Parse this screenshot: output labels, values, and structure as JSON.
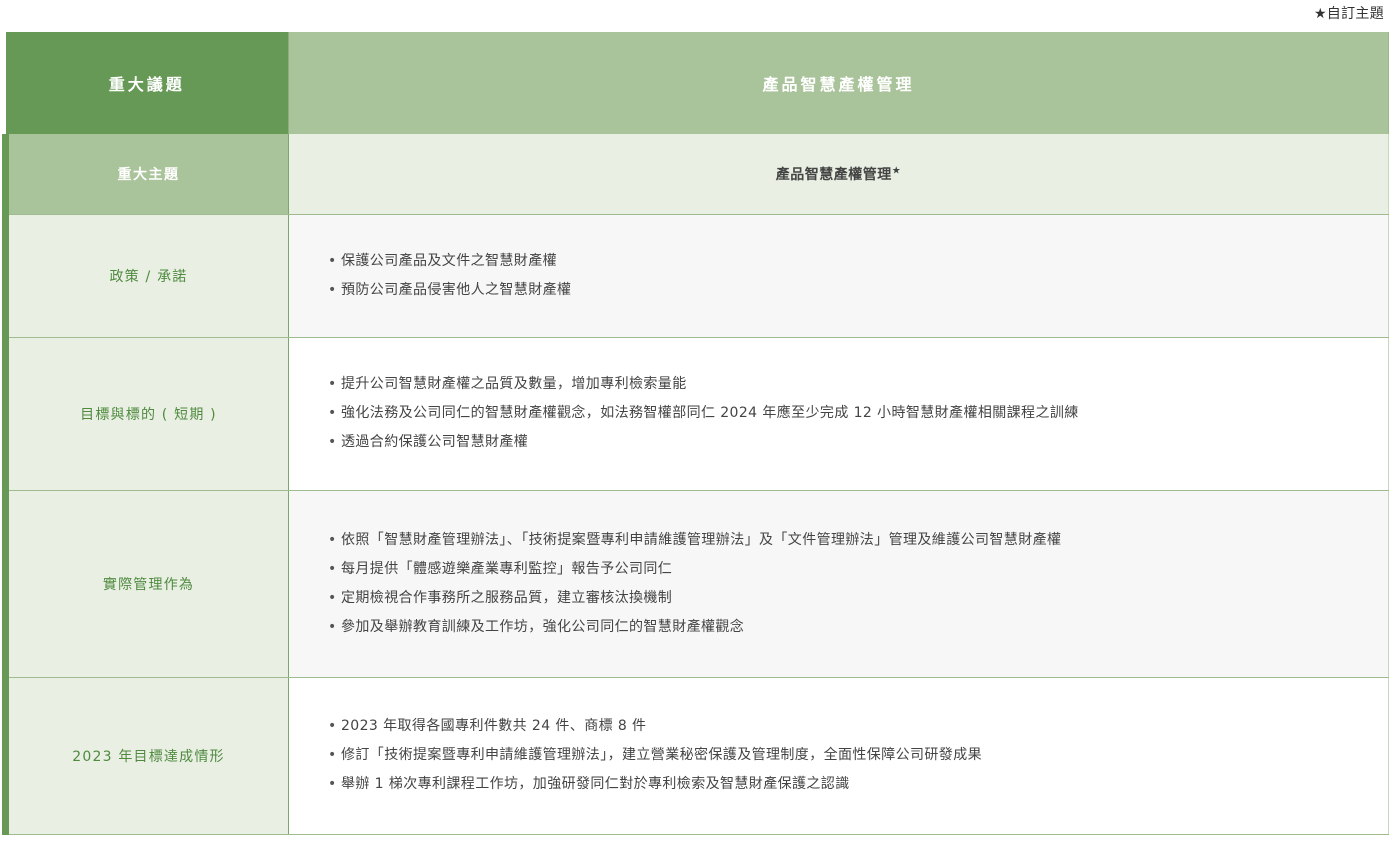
{
  "note": "★自訂主題",
  "header": {
    "left": "重大議題",
    "right": "產品智慧產權管理"
  },
  "rows": [
    {
      "label": "重大主題",
      "title": "產品智慧產權管理",
      "star": "★"
    },
    {
      "label": "政策 / 承諾",
      "items": [
        "保護公司產品及文件之智慧財產權",
        "預防公司產品侵害他人之智慧財產權"
      ]
    },
    {
      "label": "目標與標的 ( 短期 )",
      "items": [
        "提升公司智慧財產權之品質及數量，增加專利檢索量能",
        "強化法務及公司同仁的智慧財產權觀念，如法務智權部同仁 2024 年應至少完成 12 小時智慧財產權相關課程之訓練",
        "透過合約保護公司智慧財產權"
      ]
    },
    {
      "label": "實際管理作為",
      "items": [
        "依照「智慧財產管理辦法」、「技術提案暨專利申請維護管理辦法」及「文件管理辦法」管理及維護公司智慧財產權",
        "每月提供「體感遊樂產業專利監控」報告予公司同仁",
        "定期檢視合作事務所之服務品質，建立審核汰換機制",
        "參加及舉辦教育訓練及工作坊，強化公司同仁的智慧財產權觀念"
      ]
    },
    {
      "label": "2023 年目標達成情形",
      "items": [
        "2023 年取得各國專利件數共 24 件、商標 8 件",
        "修訂「技術提案暨專利申請維護管理辦法」，建立營業秘密保護及管理制度，全面性保障公司研發成果",
        "舉辦 1 梯次專利課程工作坊，加強研發同仁對於專利檢索及智慧財產保護之認識"
      ]
    }
  ]
}
